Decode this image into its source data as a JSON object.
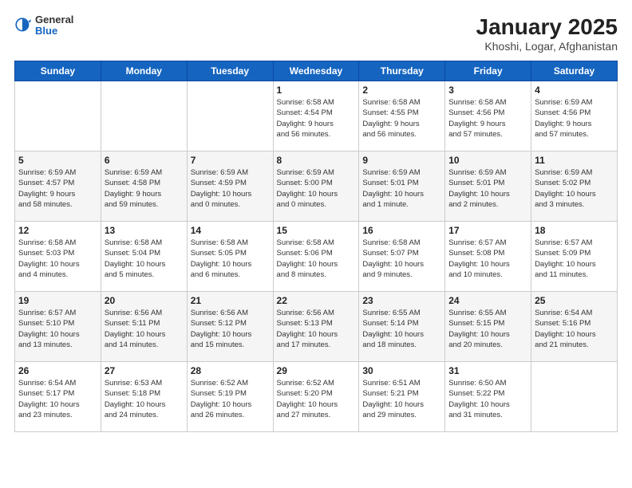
{
  "logo": {
    "general": "General",
    "blue": "Blue"
  },
  "title": "January 2025",
  "subtitle": "Khoshi, Logar, Afghanistan",
  "weekdays": [
    "Sunday",
    "Monday",
    "Tuesday",
    "Wednesday",
    "Thursday",
    "Friday",
    "Saturday"
  ],
  "weeks": [
    [
      {
        "day": "",
        "info": ""
      },
      {
        "day": "",
        "info": ""
      },
      {
        "day": "",
        "info": ""
      },
      {
        "day": "1",
        "info": "Sunrise: 6:58 AM\nSunset: 4:54 PM\nDaylight: 9 hours\nand 56 minutes."
      },
      {
        "day": "2",
        "info": "Sunrise: 6:58 AM\nSunset: 4:55 PM\nDaylight: 9 hours\nand 56 minutes."
      },
      {
        "day": "3",
        "info": "Sunrise: 6:58 AM\nSunset: 4:56 PM\nDaylight: 9 hours\nand 57 minutes."
      },
      {
        "day": "4",
        "info": "Sunrise: 6:59 AM\nSunset: 4:56 PM\nDaylight: 9 hours\nand 57 minutes."
      }
    ],
    [
      {
        "day": "5",
        "info": "Sunrise: 6:59 AM\nSunset: 4:57 PM\nDaylight: 9 hours\nand 58 minutes."
      },
      {
        "day": "6",
        "info": "Sunrise: 6:59 AM\nSunset: 4:58 PM\nDaylight: 9 hours\nand 59 minutes."
      },
      {
        "day": "7",
        "info": "Sunrise: 6:59 AM\nSunset: 4:59 PM\nDaylight: 10 hours\nand 0 minutes."
      },
      {
        "day": "8",
        "info": "Sunrise: 6:59 AM\nSunset: 5:00 PM\nDaylight: 10 hours\nand 0 minutes."
      },
      {
        "day": "9",
        "info": "Sunrise: 6:59 AM\nSunset: 5:01 PM\nDaylight: 10 hours\nand 1 minute."
      },
      {
        "day": "10",
        "info": "Sunrise: 6:59 AM\nSunset: 5:01 PM\nDaylight: 10 hours\nand 2 minutes."
      },
      {
        "day": "11",
        "info": "Sunrise: 6:59 AM\nSunset: 5:02 PM\nDaylight: 10 hours\nand 3 minutes."
      }
    ],
    [
      {
        "day": "12",
        "info": "Sunrise: 6:58 AM\nSunset: 5:03 PM\nDaylight: 10 hours\nand 4 minutes."
      },
      {
        "day": "13",
        "info": "Sunrise: 6:58 AM\nSunset: 5:04 PM\nDaylight: 10 hours\nand 5 minutes."
      },
      {
        "day": "14",
        "info": "Sunrise: 6:58 AM\nSunset: 5:05 PM\nDaylight: 10 hours\nand 6 minutes."
      },
      {
        "day": "15",
        "info": "Sunrise: 6:58 AM\nSunset: 5:06 PM\nDaylight: 10 hours\nand 8 minutes."
      },
      {
        "day": "16",
        "info": "Sunrise: 6:58 AM\nSunset: 5:07 PM\nDaylight: 10 hours\nand 9 minutes."
      },
      {
        "day": "17",
        "info": "Sunrise: 6:57 AM\nSunset: 5:08 PM\nDaylight: 10 hours\nand 10 minutes."
      },
      {
        "day": "18",
        "info": "Sunrise: 6:57 AM\nSunset: 5:09 PM\nDaylight: 10 hours\nand 11 minutes."
      }
    ],
    [
      {
        "day": "19",
        "info": "Sunrise: 6:57 AM\nSunset: 5:10 PM\nDaylight: 10 hours\nand 13 minutes."
      },
      {
        "day": "20",
        "info": "Sunrise: 6:56 AM\nSunset: 5:11 PM\nDaylight: 10 hours\nand 14 minutes."
      },
      {
        "day": "21",
        "info": "Sunrise: 6:56 AM\nSunset: 5:12 PM\nDaylight: 10 hours\nand 15 minutes."
      },
      {
        "day": "22",
        "info": "Sunrise: 6:56 AM\nSunset: 5:13 PM\nDaylight: 10 hours\nand 17 minutes."
      },
      {
        "day": "23",
        "info": "Sunrise: 6:55 AM\nSunset: 5:14 PM\nDaylight: 10 hours\nand 18 minutes."
      },
      {
        "day": "24",
        "info": "Sunrise: 6:55 AM\nSunset: 5:15 PM\nDaylight: 10 hours\nand 20 minutes."
      },
      {
        "day": "25",
        "info": "Sunrise: 6:54 AM\nSunset: 5:16 PM\nDaylight: 10 hours\nand 21 minutes."
      }
    ],
    [
      {
        "day": "26",
        "info": "Sunrise: 6:54 AM\nSunset: 5:17 PM\nDaylight: 10 hours\nand 23 minutes."
      },
      {
        "day": "27",
        "info": "Sunrise: 6:53 AM\nSunset: 5:18 PM\nDaylight: 10 hours\nand 24 minutes."
      },
      {
        "day": "28",
        "info": "Sunrise: 6:52 AM\nSunset: 5:19 PM\nDaylight: 10 hours\nand 26 minutes."
      },
      {
        "day": "29",
        "info": "Sunrise: 6:52 AM\nSunset: 5:20 PM\nDaylight: 10 hours\nand 27 minutes."
      },
      {
        "day": "30",
        "info": "Sunrise: 6:51 AM\nSunset: 5:21 PM\nDaylight: 10 hours\nand 29 minutes."
      },
      {
        "day": "31",
        "info": "Sunrise: 6:50 AM\nSunset: 5:22 PM\nDaylight: 10 hours\nand 31 minutes."
      },
      {
        "day": "",
        "info": ""
      }
    ]
  ]
}
